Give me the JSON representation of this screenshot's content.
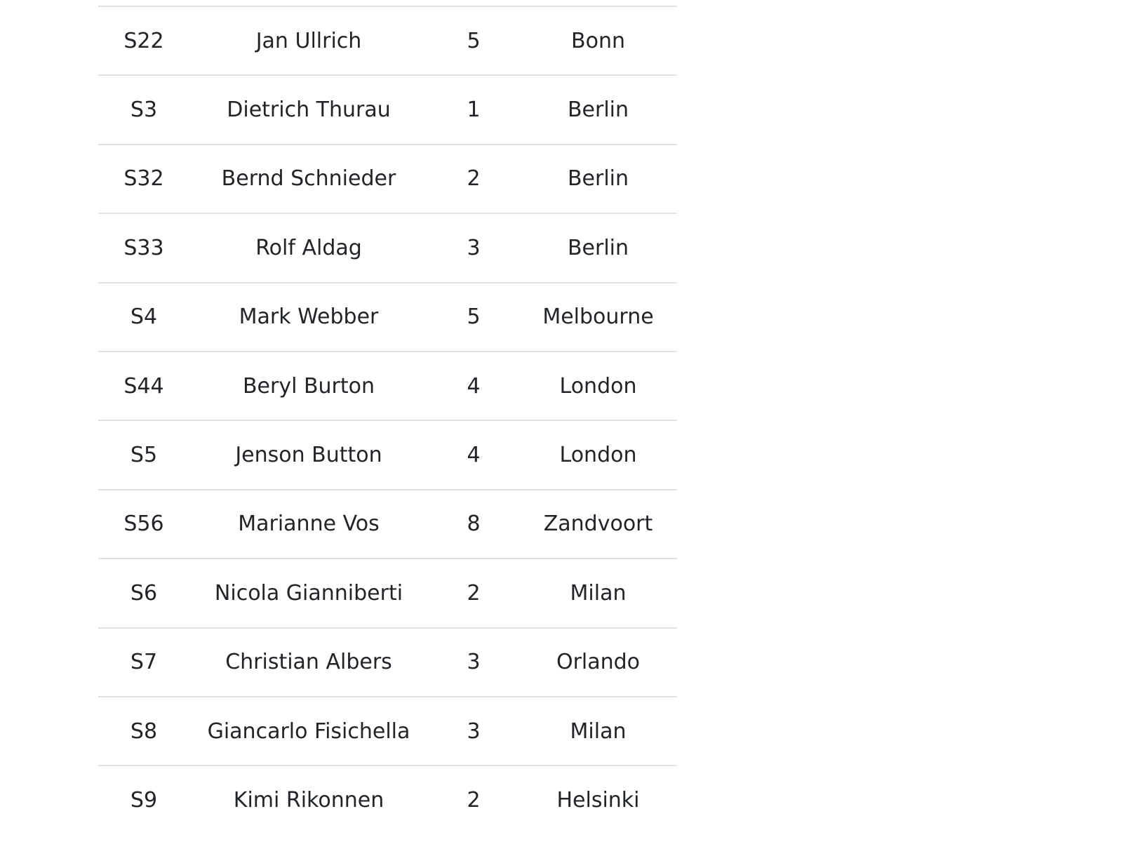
{
  "table": {
    "rows": [
      {
        "id": "S22",
        "name": "Jan Ullrich",
        "number": "5",
        "city": "Bonn"
      },
      {
        "id": "S3",
        "name": "Dietrich Thurau",
        "number": "1",
        "city": "Berlin"
      },
      {
        "id": "S32",
        "name": "Bernd Schnieder",
        "number": "2",
        "city": "Berlin"
      },
      {
        "id": "S33",
        "name": "Rolf Aldag",
        "number": "3",
        "city": "Berlin"
      },
      {
        "id": "S4",
        "name": "Mark Webber",
        "number": "5",
        "city": "Melbourne"
      },
      {
        "id": "S44",
        "name": "Beryl Burton",
        "number": "4",
        "city": "London"
      },
      {
        "id": "S5",
        "name": "Jenson Button",
        "number": "4",
        "city": "London"
      },
      {
        "id": "S56",
        "name": "Marianne Vos",
        "number": "8",
        "city": "Zandvoort"
      },
      {
        "id": "S6",
        "name": "Nicola Gianniberti",
        "number": "2",
        "city": "Milan"
      },
      {
        "id": "S7",
        "name": "Christian Albers",
        "number": "3",
        "city": "Orlando"
      },
      {
        "id": "S8",
        "name": "Giancarlo Fisichella",
        "number": "3",
        "city": "Milan"
      },
      {
        "id": "S9",
        "name": "Kimi Rikonnen",
        "number": "2",
        "city": "Helsinki"
      }
    ]
  }
}
